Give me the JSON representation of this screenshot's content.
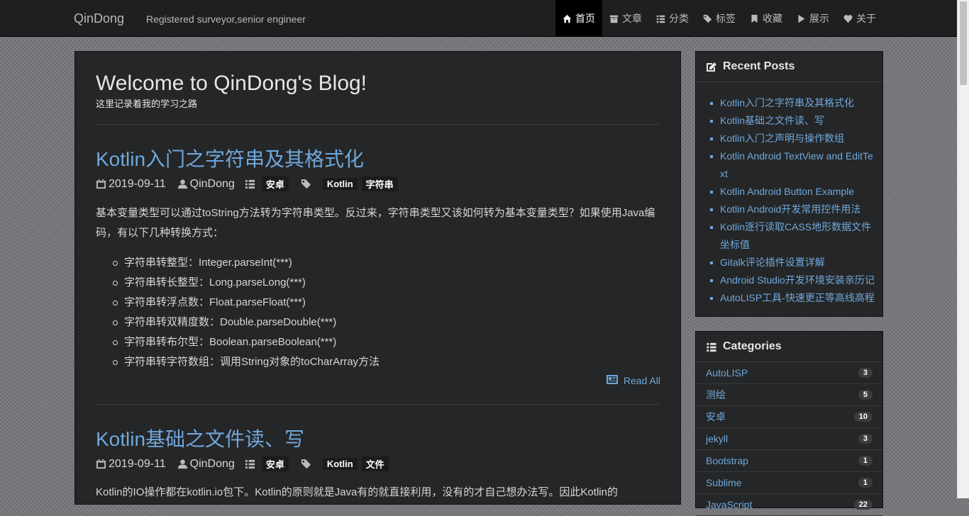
{
  "navbar": {
    "brand": "QinDong",
    "tagline": "Registered surveyor,senior engineer",
    "items": [
      {
        "label": "首页",
        "icon": "home-icon"
      },
      {
        "label": "文章",
        "icon": "archive-icon"
      },
      {
        "label": "分类",
        "icon": "list-icon"
      },
      {
        "label": "标签",
        "icon": "tags-icon"
      },
      {
        "label": "收藏",
        "icon": "bookmark-icon"
      },
      {
        "label": "展示",
        "icon": "play-icon"
      },
      {
        "label": "关于",
        "icon": "heart-icon"
      }
    ]
  },
  "main": {
    "title": "Welcome to QinDong's Blog!",
    "subtitle": "这里记录着我的学习之路",
    "posts": [
      {
        "title": "Kotlin入门之字符串及其格式化",
        "date": "2019-09-11",
        "author": "QinDong",
        "category": "安卓",
        "tags": [
          "Kotlin",
          "字符串"
        ],
        "excerpt": "基本变量类型可以通过toString方法转为字符串类型。反过来，字符串类型又该如何转为基本变量类型？如果使用Java编码，有以下几种转换方式：",
        "bullets": [
          "字符串转整型：Integer.parseInt(***)",
          "字符串转长整型：Long.parseLong(***)",
          "字符串转浮点数：Float.parseFloat(***)",
          "字符串转双精度数：Double.parseDouble(***)",
          "字符串转布尔型：Boolean.parseBoolean(***)",
          "字符串转字符数组：调用String对象的toCharArray方法"
        ],
        "read_all": "Read All"
      },
      {
        "title": "Kotlin基础之文件读、写",
        "date": "2019-09-11",
        "author": "QinDong",
        "category": "安卓",
        "tags": [
          "Kotlin",
          "文件"
        ],
        "excerpt": "Kotlin的IO操作都在kotlin.io包下。Kotlin的原则就是Java有的就直接利用，没有的才自己想办法写。因此Kotlin的"
      }
    ]
  },
  "sidebar": {
    "recent_title": "Recent Posts",
    "recent_posts": [
      "Kotlin入门之字符串及其格式化",
      "Kotlin基础之文件读、写",
      "Kotlin入门之声明与操作数组",
      "Kotlin Android TextView and EditText",
      "Kotlin Android Button Example",
      "Kotlin Android开发常用控件用法",
      "Kotlin逐行读取CASS地形数据文件坐标值",
      "Gitalk评论插件设置详解",
      "Android Studio开发环境安装亲历记",
      "AutoLISP工具-快速更正等高线高程"
    ],
    "categories_title": "Categories",
    "categories": [
      {
        "name": "AutoLISP",
        "count": "3"
      },
      {
        "name": "测绘",
        "count": "5"
      },
      {
        "name": "安卓",
        "count": "10"
      },
      {
        "name": "jekyll",
        "count": "3"
      },
      {
        "name": "Bootstrap",
        "count": "1"
      },
      {
        "name": "Sublime",
        "count": "1"
      },
      {
        "name": "JavaScript",
        "count": "22"
      }
    ]
  }
}
